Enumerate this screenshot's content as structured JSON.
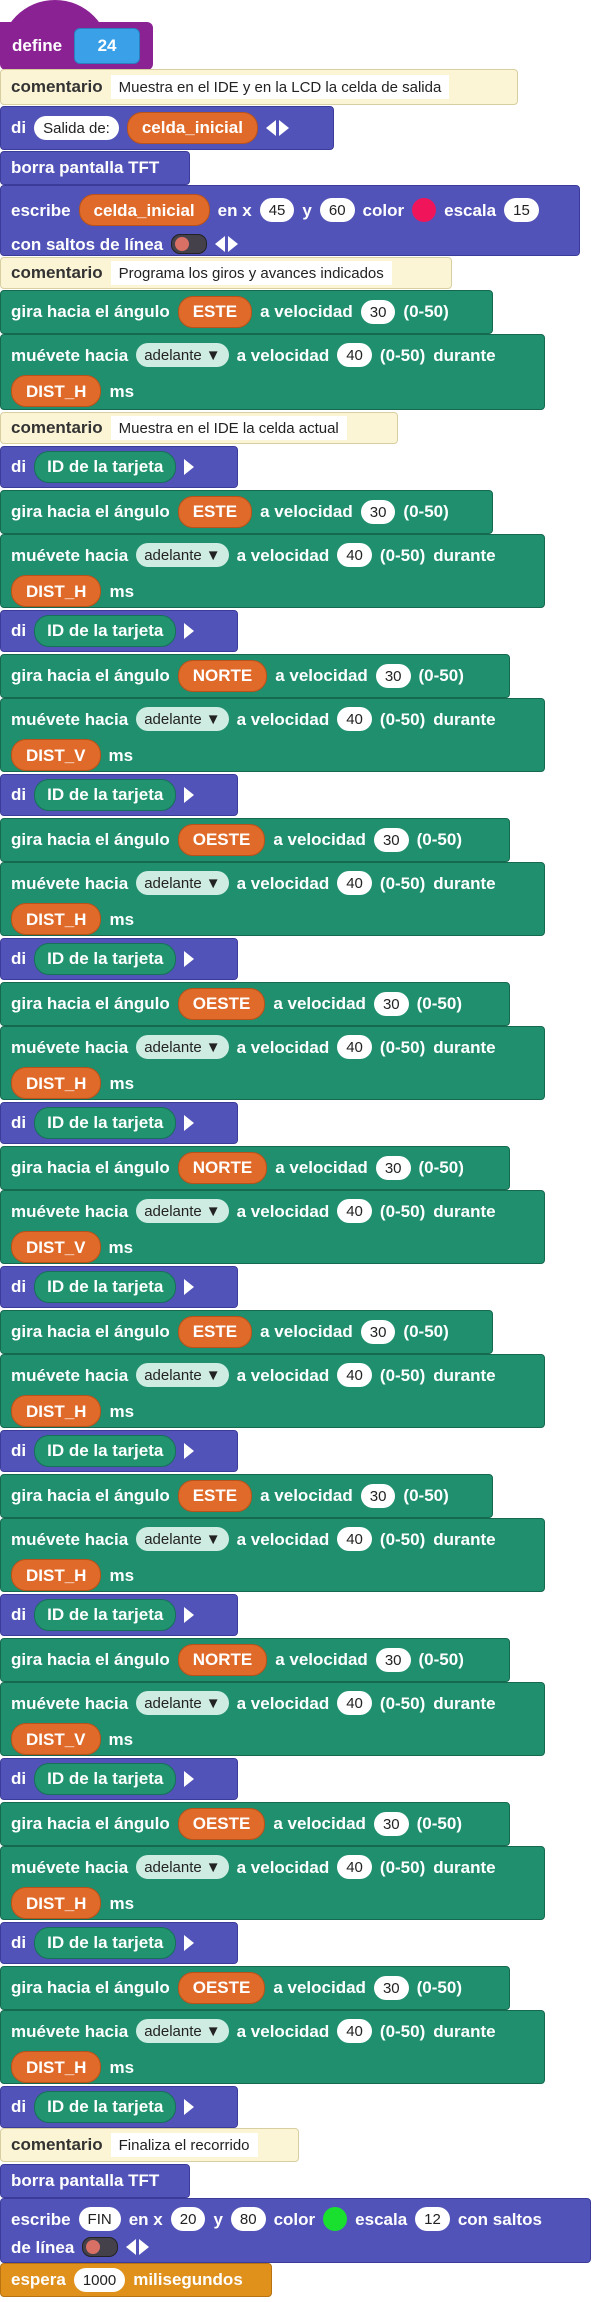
{
  "define": {
    "label": "define",
    "value": "24"
  },
  "labels": {
    "comentario": "comentario",
    "di": "di",
    "borra": "borra pantalla TFT",
    "escribe": "escribe",
    "en_x": "en x",
    "y": "y",
    "color": "color",
    "escala": "escala",
    "con_saltos": "con saltos de línea",
    "con_saltos_a": "con saltos",
    "de_linea": "de línea",
    "gira": "gira hacia el ángulo",
    "a_velocidad": "a velocidad",
    "rango": "(0-50)",
    "muevete": "muévete hacia",
    "durante": "durante",
    "ms": "ms",
    "espera": "espera",
    "milisegundos": "milisegundos",
    "id_tarjeta": "ID de la tarjeta"
  },
  "comments": {
    "c1": "Muestra en el IDE y en la LCD la celda de salida",
    "c2": "Programa los giros y avances indicados",
    "c3": "Muestra en el IDE la celda actual",
    "c4": "Finaliza el recorrido"
  },
  "di_first": {
    "text": "Salida de:",
    "var": "celda_inicial"
  },
  "escribe1": {
    "var": "celda_inicial",
    "x": "45",
    "y": "60",
    "color": "#f0145a",
    "escala": "15"
  },
  "escribe2": {
    "text": "FIN",
    "x": "20",
    "y": "80",
    "color": "#19e02e",
    "escala": "12"
  },
  "espera": {
    "value": "1000"
  },
  "gira_speed": "30",
  "move_speed": "40",
  "move_dir": "adelante",
  "steps": [
    {
      "angle": "ESTE",
      "dist": "DIST_H"
    },
    {
      "angle": "ESTE",
      "dist": "DIST_H"
    },
    {
      "angle": "NORTE",
      "dist": "DIST_V"
    },
    {
      "angle": "OESTE",
      "dist": "DIST_H"
    },
    {
      "angle": "OESTE",
      "dist": "DIST_H"
    },
    {
      "angle": "NORTE",
      "dist": "DIST_V"
    },
    {
      "angle": "ESTE",
      "dist": "DIST_H"
    },
    {
      "angle": "ESTE",
      "dist": "DIST_H"
    },
    {
      "angle": "NORTE",
      "dist": "DIST_V"
    },
    {
      "angle": "OESTE",
      "dist": "DIST_H"
    },
    {
      "angle": "OESTE",
      "dist": "DIST_H"
    }
  ]
}
